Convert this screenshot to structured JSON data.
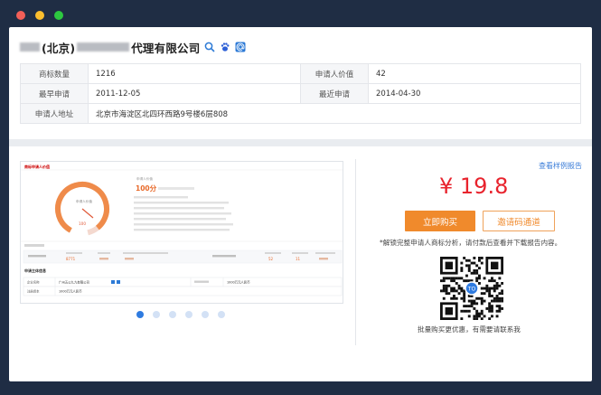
{
  "window": {
    "dots": [
      "#f25f58",
      "#fbbe2e",
      "#2dc840"
    ]
  },
  "company": {
    "name_prefix": "(北京)",
    "name_suffix": "代理有限公司"
  },
  "info": {
    "rows": [
      {
        "k1": "商标数量",
        "v1": "1216",
        "k2": "申请人价值",
        "v2": "42"
      },
      {
        "k1": "最早申请",
        "v1": "2011-12-05",
        "k2": "最近申请",
        "v2": "2014-04-30"
      }
    ],
    "address_label": "申请人地址",
    "address_value": "北京市海淀区北四环西路9号楼6层808"
  },
  "preview": {
    "title": "商标申请人价值",
    "score_label": "申请人价值",
    "score": "100分",
    "gauge_value": "100",
    "gauge_fraction": 0.92,
    "section_title": "申请主体信息",
    "company_field": "企业名称",
    "company_value": "广州五公九九有限公司",
    "reg_field": "注册资本",
    "reg_value": "1000万元人民币",
    "stat_values": [
      "8771",
      "52",
      "11"
    ]
  },
  "pager": {
    "count": 6,
    "active": 0
  },
  "sidebar": {
    "sample_link": "查看样例报告",
    "price": "¥ 19.8",
    "buy_button": "立即购买",
    "invite_button": "邀请码通道",
    "notice": "*解锁完整申请人商标分析，请付款后查看并下载报告内容。",
    "bulk_notice": "批量购买更优惠，有需要请联系我",
    "qr_badge": "TO"
  },
  "colors": {
    "accent": "#f08a2c",
    "price": "#e8232d",
    "link": "#3b7dd8"
  }
}
